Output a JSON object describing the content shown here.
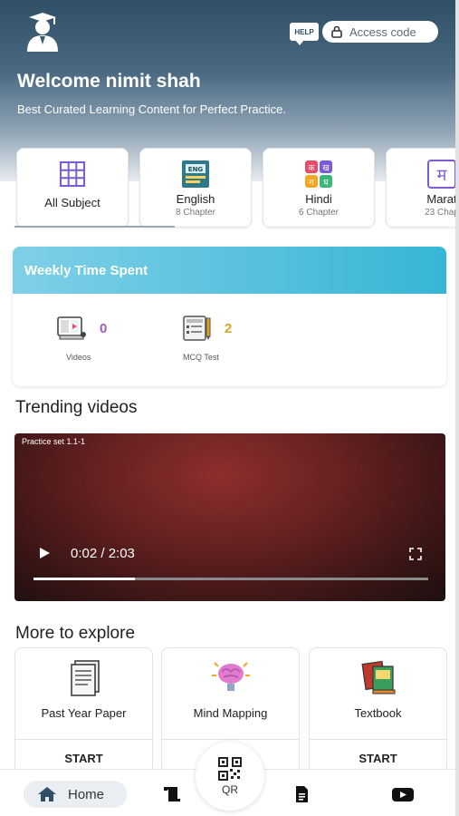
{
  "header": {
    "help_label": "HELP",
    "access_label": "Access code",
    "welcome": "Welcome nimit shah",
    "tagline": "Best Curated Learning Content for Perfect Practice."
  },
  "subjects": [
    {
      "name": "All Subject",
      "chapters": "",
      "icon": "grid-icon"
    },
    {
      "name": "English",
      "chapters": "8 Chapter",
      "icon": "english-book-icon"
    },
    {
      "name": "Hindi",
      "chapters": "6 Chapter",
      "icon": "hindi-letters-icon"
    },
    {
      "name": "Marat",
      "chapters": "23 Chap",
      "icon": "marathi-letter-icon"
    }
  ],
  "weekly": {
    "title": "Weekly Time Spent",
    "videos_count": "0",
    "videos_label": "Videos",
    "mcq_count": "2",
    "mcq_label": "MCQ Test"
  },
  "trending": {
    "title": "Trending videos",
    "video_title": "Practice set 1.1-1",
    "time": "0:02 / 2:03",
    "progress": 0.016
  },
  "explore": {
    "title": "More to explore",
    "cards": [
      {
        "label": "Past Year Paper",
        "action": "START",
        "icon": "papers-icon"
      },
      {
        "label": "Mind Mapping",
        "action": "",
        "icon": "brain-icon"
      },
      {
        "label": "Textbook",
        "action": "START",
        "icon": "textbooks-icon"
      }
    ]
  },
  "nav": {
    "home": "Home",
    "qr": "QR"
  },
  "colors": {
    "header_dark": "#2f4f66",
    "weekly_accent": "#37b5d6",
    "videos_count": "#a05cc8",
    "mcq_count": "#e0a020"
  }
}
